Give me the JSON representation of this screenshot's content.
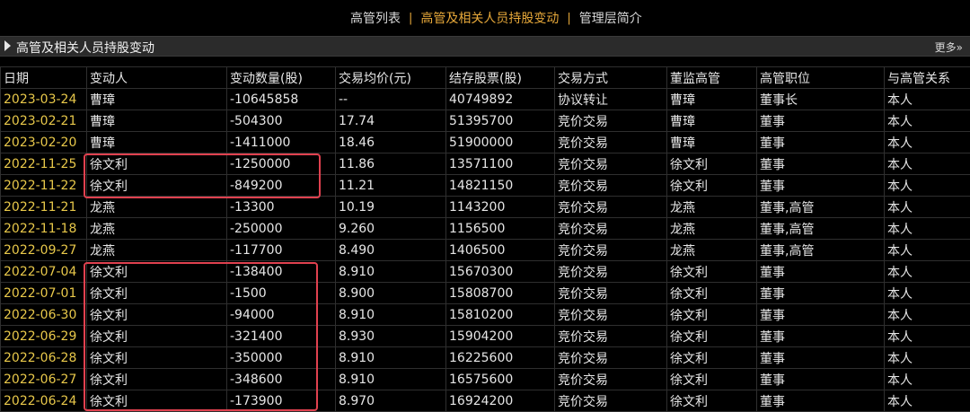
{
  "topnav": {
    "items": [
      "高管列表",
      "高管及相关人员持股变动",
      "管理层简介"
    ],
    "separator": "|"
  },
  "section": {
    "title": "高管及相关人员持股变动",
    "more": "更多»"
  },
  "table": {
    "headers": [
      "日期",
      "变动人",
      "变动数量(股)",
      "交易均价(元)",
      "结存股票(股)",
      "交易方式",
      "董监高管",
      "高管职位",
      "与高管关系"
    ],
    "rows": [
      [
        "2023-03-24",
        "曹璋",
        "-10645858",
        "--",
        "40749892",
        "协议转让",
        "曹璋",
        "董事长",
        "本人"
      ],
      [
        "2023-02-21",
        "曹璋",
        "-504300",
        "17.74",
        "51395700",
        "竞价交易",
        "曹璋",
        "董事",
        "本人"
      ],
      [
        "2023-02-20",
        "曹璋",
        "-1411000",
        "18.46",
        "51900000",
        "竞价交易",
        "曹璋",
        "董事",
        "本人"
      ],
      [
        "2022-11-25",
        "徐文利",
        "-1250000",
        "11.86",
        "13571100",
        "竞价交易",
        "徐文利",
        "董事",
        "本人"
      ],
      [
        "2022-11-22",
        "徐文利",
        "-849200",
        "11.21",
        "14821150",
        "竞价交易",
        "徐文利",
        "董事",
        "本人"
      ],
      [
        "2022-11-21",
        "龙燕",
        "-13300",
        "10.19",
        "1143200",
        "竞价交易",
        "龙燕",
        "董事,高管",
        "本人"
      ],
      [
        "2022-11-18",
        "龙燕",
        "-250000",
        "9.260",
        "1156500",
        "竞价交易",
        "龙燕",
        "董事,高管",
        "本人"
      ],
      [
        "2022-09-27",
        "龙燕",
        "-117700",
        "8.490",
        "1406500",
        "竞价交易",
        "龙燕",
        "董事,高管",
        "本人"
      ],
      [
        "2022-07-04",
        "徐文利",
        "-138400",
        "8.910",
        "15670300",
        "竞价交易",
        "徐文利",
        "董事",
        "本人"
      ],
      [
        "2022-07-01",
        "徐文利",
        "-1500",
        "8.900",
        "15808700",
        "竞价交易",
        "徐文利",
        "董事",
        "本人"
      ],
      [
        "2022-06-30",
        "徐文利",
        "-94000",
        "8.910",
        "15810200",
        "竞价交易",
        "徐文利",
        "董事",
        "本人"
      ],
      [
        "2022-06-29",
        "徐文利",
        "-321400",
        "8.930",
        "15904200",
        "竞价交易",
        "徐文利",
        "董事",
        "本人"
      ],
      [
        "2022-06-28",
        "徐文利",
        "-350000",
        "8.910",
        "16225600",
        "竞价交易",
        "徐文利",
        "董事",
        "本人"
      ],
      [
        "2022-06-27",
        "徐文利",
        "-348600",
        "8.910",
        "16575600",
        "竞价交易",
        "徐文利",
        "董事",
        "本人"
      ],
      [
        "2022-06-24",
        "徐文利",
        "-173900",
        "8.970",
        "16924200",
        "竞价交易",
        "徐文利",
        "董事",
        "本人"
      ]
    ]
  },
  "colors": {
    "accent": "#e8a93a",
    "date": "#e8c84a",
    "highlight_box": "#e0414f",
    "background": "#000000"
  }
}
